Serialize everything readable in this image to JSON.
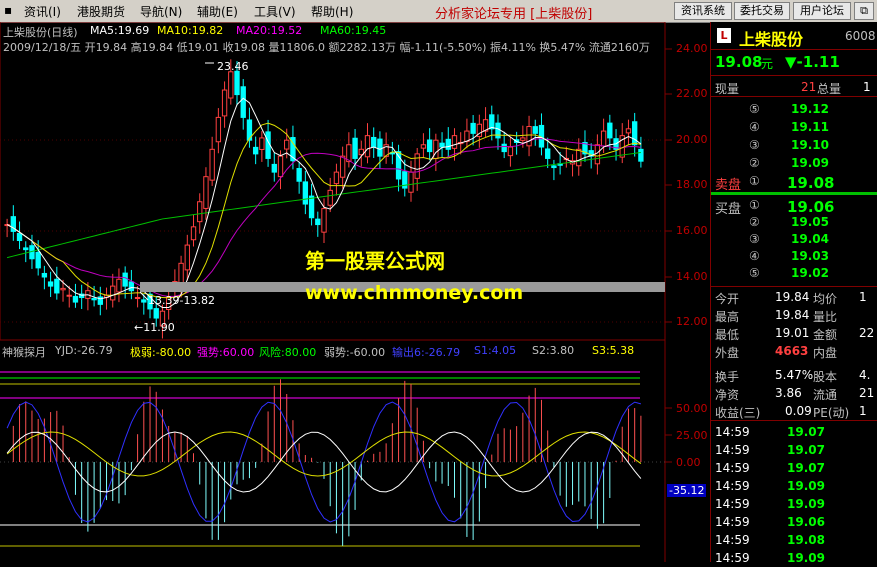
{
  "menu": {
    "items": [
      "资讯(I)",
      "港股期货",
      "导航(N)",
      "辅助(E)",
      "工具(V)",
      "帮助(H)"
    ],
    "title": "分析家论坛专用 [上柴股份]",
    "buttons": [
      "资讯系统",
      "委托交易",
      "用户论坛"
    ]
  },
  "main_chart": {
    "title": "上柴股份(日线)",
    "ma5": "MA5:19.69",
    "ma10": "MA10:19.82",
    "ma20": "MA20:19.52",
    "ma60": "MA60:19.45",
    "info_line": "2009/12/18/五 开19.84 高19.84 低19.01 收19.08 量11806.0 额2282.13万 幅-1.11(-5.50%) 振4.11% 换5.47% 流通2160万",
    "ann_high": "23.46",
    "ann_mid": "13.39-13.82",
    "ann_low": "←11.90",
    "price_axis": [
      "24.00",
      "22.00",
      "20.00",
      "18.00",
      "16.00",
      "14.00",
      "12.00"
    ]
  },
  "indicator": {
    "name": "神猴探月",
    "yjd": "YJD:-26.79",
    "jiruo": "极弱:-80.00",
    "qiangshi": "强势:60.00",
    "fengxian": "风险:80.00",
    "ruoshi": "弱势:-60.00",
    "shuchu": "输出6:-26.79",
    "s1": "S1:4.05",
    "s2": "S2:3.80",
    "s3": "S3:5.38",
    "axis": [
      "50.00",
      "25.00",
      "0.00"
    ],
    "value_badge": "-35.12"
  },
  "watermark": {
    "line1": "第一股票公式网",
    "line2": "www.chnmoney.com"
  },
  "sidebar": {
    "logo": "L",
    "name": "上柴股份",
    "code": "6008",
    "price": "19.08",
    "price_unit": "元",
    "change": "▼-1.11",
    "xianliang_label": "现量",
    "xianliang": "21",
    "zongliang_label": "总量",
    "zongliang": "1",
    "sell_label": "卖盘",
    "sell_levels": [
      {
        "num": "⑤",
        "price": "19.12"
      },
      {
        "num": "④",
        "price": "19.11"
      },
      {
        "num": "③",
        "price": "19.10"
      },
      {
        "num": "②",
        "price": "19.09"
      },
      {
        "num": "①",
        "price": "19.08"
      }
    ],
    "buy_label": "买盘",
    "buy_levels": [
      {
        "num": "①",
        "price": "19.06"
      },
      {
        "num": "②",
        "price": "19.05"
      },
      {
        "num": "③",
        "price": "19.04"
      },
      {
        "num": "④",
        "price": "19.03"
      },
      {
        "num": "⑤",
        "price": "19.02"
      }
    ],
    "stats": [
      {
        "l1": "今开",
        "v1": "19.84",
        "l2": "均价",
        "v2": "1"
      },
      {
        "l1": "最高",
        "v1": "19.84",
        "l2": "量比",
        "v2": ""
      },
      {
        "l1": "最低",
        "v1": "19.01",
        "l2": "金额",
        "v2": "22"
      },
      {
        "l1": "外盘",
        "v1": "4663",
        "l2": "内盘",
        "v2": ""
      },
      {
        "l1": "换手",
        "v1": "5.47%",
        "l2": "股本",
        "v2": "4."
      },
      {
        "l1": "净资",
        "v1": "3.86",
        "l2": "流通",
        "v2": "21"
      },
      {
        "l1": "收益(三)",
        "v1": "0.09",
        "l2": "PE(动)",
        "v2": "1"
      }
    ],
    "ticks": [
      {
        "t": "14:59",
        "p": "19.07"
      },
      {
        "t": "14:59",
        "p": "19.07"
      },
      {
        "t": "14:59",
        "p": "19.07"
      },
      {
        "t": "14:59",
        "p": "19.09"
      },
      {
        "t": "14:59",
        "p": "19.09"
      },
      {
        "t": "14:59",
        "p": "19.06"
      },
      {
        "t": "14:59",
        "p": "19.08"
      },
      {
        "t": "14:59",
        "p": "19.09"
      }
    ]
  }
}
